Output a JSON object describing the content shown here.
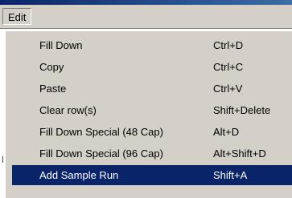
{
  "menu": {
    "title": "Edit",
    "items": [
      {
        "label": "Fill Down",
        "shortcut": "Ctrl+D"
      },
      {
        "label": "Copy",
        "shortcut": "Ctrl+C"
      },
      {
        "label": "Paste",
        "shortcut": "Ctrl+V"
      },
      {
        "label": "Clear row(s)",
        "shortcut": "Shift+Delete"
      },
      {
        "label": "Fill Down Special (48 Cap)",
        "shortcut": "Alt+D"
      },
      {
        "label": "Fill Down Special (96 Cap)",
        "shortcut": "Alt+Shift+D"
      },
      {
        "label": "Add Sample Run",
        "shortcut": "Shift+A",
        "selected": true
      }
    ]
  },
  "colors": {
    "menu_background": "#d4d0c8",
    "highlight": "#0a246a",
    "highlight_text": "#ffffff"
  }
}
